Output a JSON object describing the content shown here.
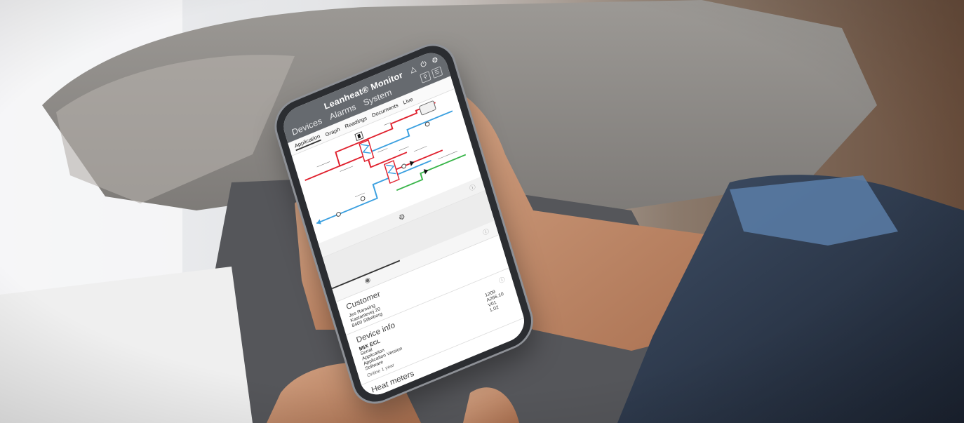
{
  "app": {
    "title": "Leanheat® Monitor",
    "nav": [
      "Devices",
      "Alarms",
      "System"
    ],
    "subtabs": [
      "Application",
      "Graph",
      "Readings",
      "Documents",
      "Live"
    ],
    "active_subtab": "Application"
  },
  "customer": {
    "heading": "Customer",
    "lines": [
      "Jes Ramsing",
      "Kastanievej 20",
      "8400 Silkeborg"
    ]
  },
  "device_info": {
    "heading": "Device info",
    "model": "MIX ECL",
    "labels": [
      "Serial",
      "Application",
      "Application Version",
      "Software"
    ],
    "values": [
      "1209",
      "A266.10",
      "V01",
      "1.02"
    ],
    "footer": "Online 1 year"
  },
  "heat_meters": {
    "heading": "Heat meters"
  },
  "colors": {
    "supply": "#e0212e",
    "return": "#3ba0e0",
    "secondary": "#39b54a",
    "appbar": "#666a6f"
  }
}
